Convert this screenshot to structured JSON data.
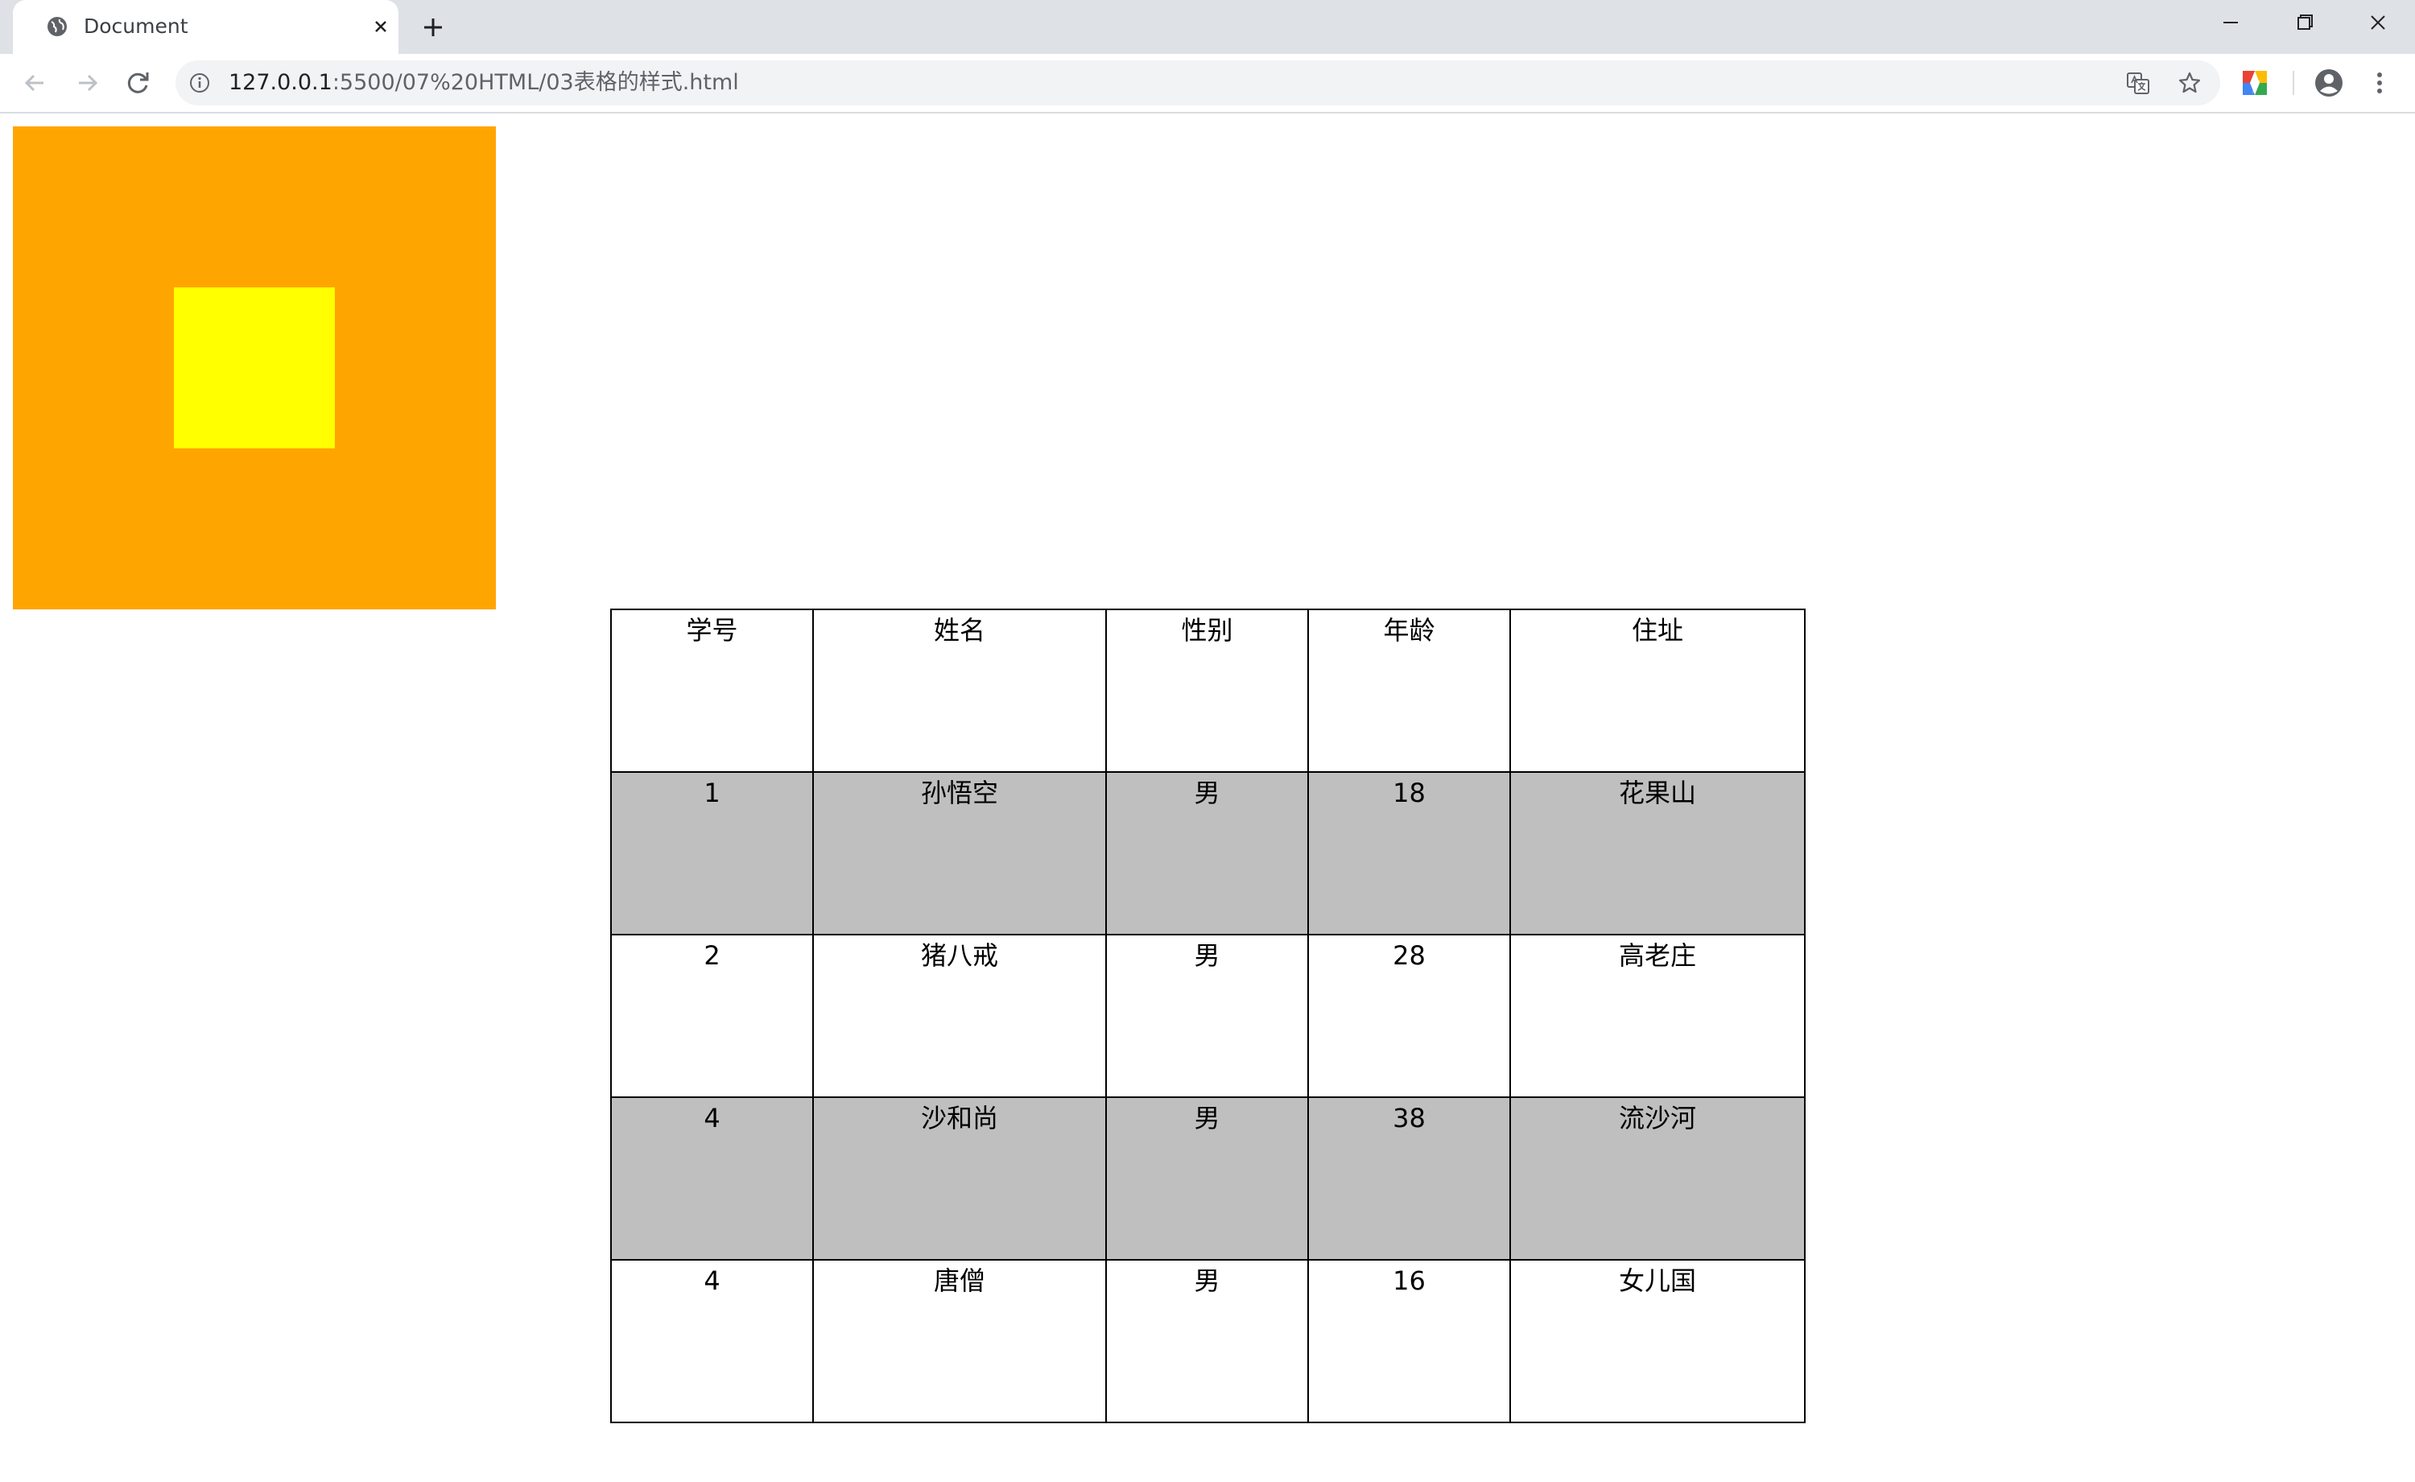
{
  "browser": {
    "tab_title": "Document",
    "url_host": "127.0.0.1",
    "url_path": ":5500/07%20HTML/03表格的样式.html"
  },
  "page": {
    "colors": {
      "outer_box": "#ffa500",
      "inner_box": "#ffff00",
      "striped_row": "#bfbfbf",
      "plain_row": "#ffffff"
    },
    "table": {
      "headers": [
        "学号",
        "姓名",
        "性别",
        "年龄",
        "住址"
      ],
      "rows": [
        [
          "1",
          "孙悟空",
          "男",
          "18",
          "花果山"
        ],
        [
          "2",
          "猪八戒",
          "男",
          "28",
          "高老庄"
        ],
        [
          "4",
          "沙和尚",
          "男",
          "38",
          "流沙河"
        ],
        [
          "4",
          "唐僧",
          "男",
          "16",
          "女儿国"
        ]
      ]
    }
  },
  "icons": {
    "favicon": "globe-icon",
    "tab_close": "close-icon",
    "new_tab": "plus-icon",
    "back": "arrow-left-icon",
    "forward": "arrow-right-icon",
    "reload": "reload-icon",
    "site_info": "info-icon",
    "translate": "translate-icon",
    "bookmark": "star-icon",
    "extension": "extension-icon",
    "profile": "profile-icon",
    "menu": "kebab-menu-icon"
  }
}
